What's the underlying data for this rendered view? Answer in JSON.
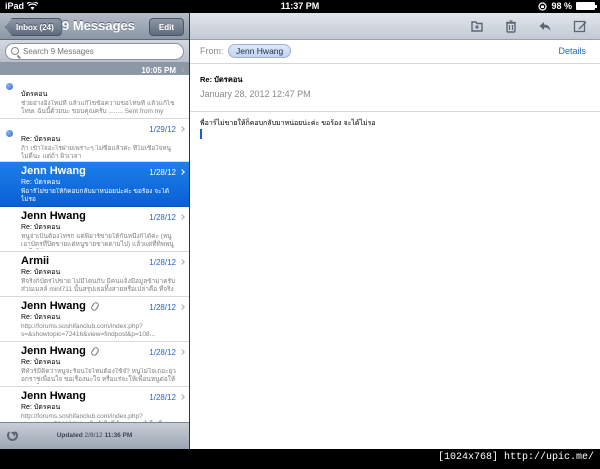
{
  "status_bar": {
    "carrier": "iPad",
    "time": "11:37 PM",
    "battery_percent": "98 %",
    "battery_level": 0.98
  },
  "colors": {
    "accent_blue": "#2a64c9",
    "selected_row": "#1b80ea",
    "toolbar_slate": "#8a96a5"
  },
  "mailbox": {
    "back_button": "Inbox (24)",
    "title": "9 Messages",
    "edit_button": "Edit",
    "search_placeholder": "Search 9 Messages",
    "updated_label": "Updated",
    "updated_date": "2/8/12",
    "updated_time": "11:36 PM"
  },
  "messages": [
    {
      "sender": "",
      "date": "10:05 PM",
      "subject": "บัตรคอน",
      "preview": "ช่วยอ่างอิงใหม่ที แล้วแก้ไขข้อความขอโทษที แล้วแก้ไขโทษเ ฉันนี้ด้วยนะ ขอบคุณครับ ........ Sent from my iPhone",
      "unread": true,
      "attachment": false,
      "selected": false
    },
    {
      "sender": "",
      "date": "1/29/12",
      "subject": "Re: บัตรคอน",
      "preview": "ถ้า เข้าใจอะไรผ่ายเพราะๆ ไม่ซื้อแล้วค่ะ ที่ไม่เชื่อใจหนู ไม่ดีนะ แต่ถ้า ผิวเวลา",
      "unread": true,
      "attachment": false,
      "selected": false
    },
    {
      "sender": "Jenn Hwang",
      "date": "1/28/12",
      "subject": "Re: บัตรคอน",
      "preview": "พี่อาร์ไม่ขายให้ก็คอบกลับมาหน่อยน่ะค่ะ ขอร้อง จะได้ไม่รอ",
      "unread": false,
      "attachment": false,
      "selected": true
    },
    {
      "sender": "Jenn Hwang",
      "date": "1/28/12",
      "subject": "Re: บัตรคอน",
      "preview": "หนูจ่าเป็นต้องโทรก แต่พี่อาร์ขายให้กันหนึ่งก็ได้ค่ะ (หนู เอาบัตรที่ปิดขายแต่หนูขายขาดตามไป) แล้วแต่ที่ทิพพนูขาใจได้",
      "unread": false,
      "attachment": false,
      "selected": false
    },
    {
      "sender": "Armii",
      "date": "1/28/12",
      "subject": "Re: บัตรคอน",
      "preview": "ที่จริงก็บัตรไปขาย ไม่มีโดนกับ มีคนแจ้งมีอมูลข้ามาครับ ส่วนเมลล์ mint711 นั้นสรุปเธอทิ้งสายหรือเปล่าคือ ที่จริง ??? ผิด",
      "unread": false,
      "attachment": false,
      "selected": false
    },
    {
      "sender": "Jenn Hwang",
      "date": "1/28/12",
      "subject": "Re: บัตรคอน",
      "preview": "http://forums.soshifanclub.com/index.php?s=&showtopic=72416&view=findpost&p=108...",
      "unread": false,
      "attachment": true,
      "selected": false
    },
    {
      "sender": "Jenn Hwang",
      "date": "1/28/12",
      "subject": "Re: บัตรคอน",
      "preview": "ที่ทัวร์มีคิดว่าหนูจะร้อนใจไหมต้องใช้จ๋? หนูไม่ใจเถอะยุวอกราชเพื่อนใจ ขอเรื่องนะใจ หรือแร่จะให้เพื่อนหนูต่อให้ยอมเพื่อหนูค่ะ",
      "unread": false,
      "attachment": true,
      "selected": false
    },
    {
      "sender": "Jenn Hwang",
      "date": "1/28/12",
      "subject": "Re: บัตรคอน",
      "preview": "http://forums.soshifanclub.com/index.php?showtopic=72416&hl= เดิมยังไม่ได้จองเลย ทำไมพี่เราว่าโอย่างแรกจึงถามไหม",
      "unread": false,
      "attachment": false,
      "selected": false
    }
  ],
  "message_view": {
    "from_label": "From:",
    "from_name": "Jenn Hwang",
    "details_link": "Details",
    "subject": "Re: บัตรคอน",
    "date": "January 28, 2012 12:47 PM",
    "body": "พี่อาร์ไม่ขายให้ก็คอบกลับมาหน่อยน่ะค่ะ ขอร้อง จะได้ไม่รอ"
  },
  "toolbar_icons": [
    "folder-icon",
    "trash-icon",
    "reply-icon",
    "compose-icon"
  ],
  "watermark": "[1024x768] http://upic.me/"
}
